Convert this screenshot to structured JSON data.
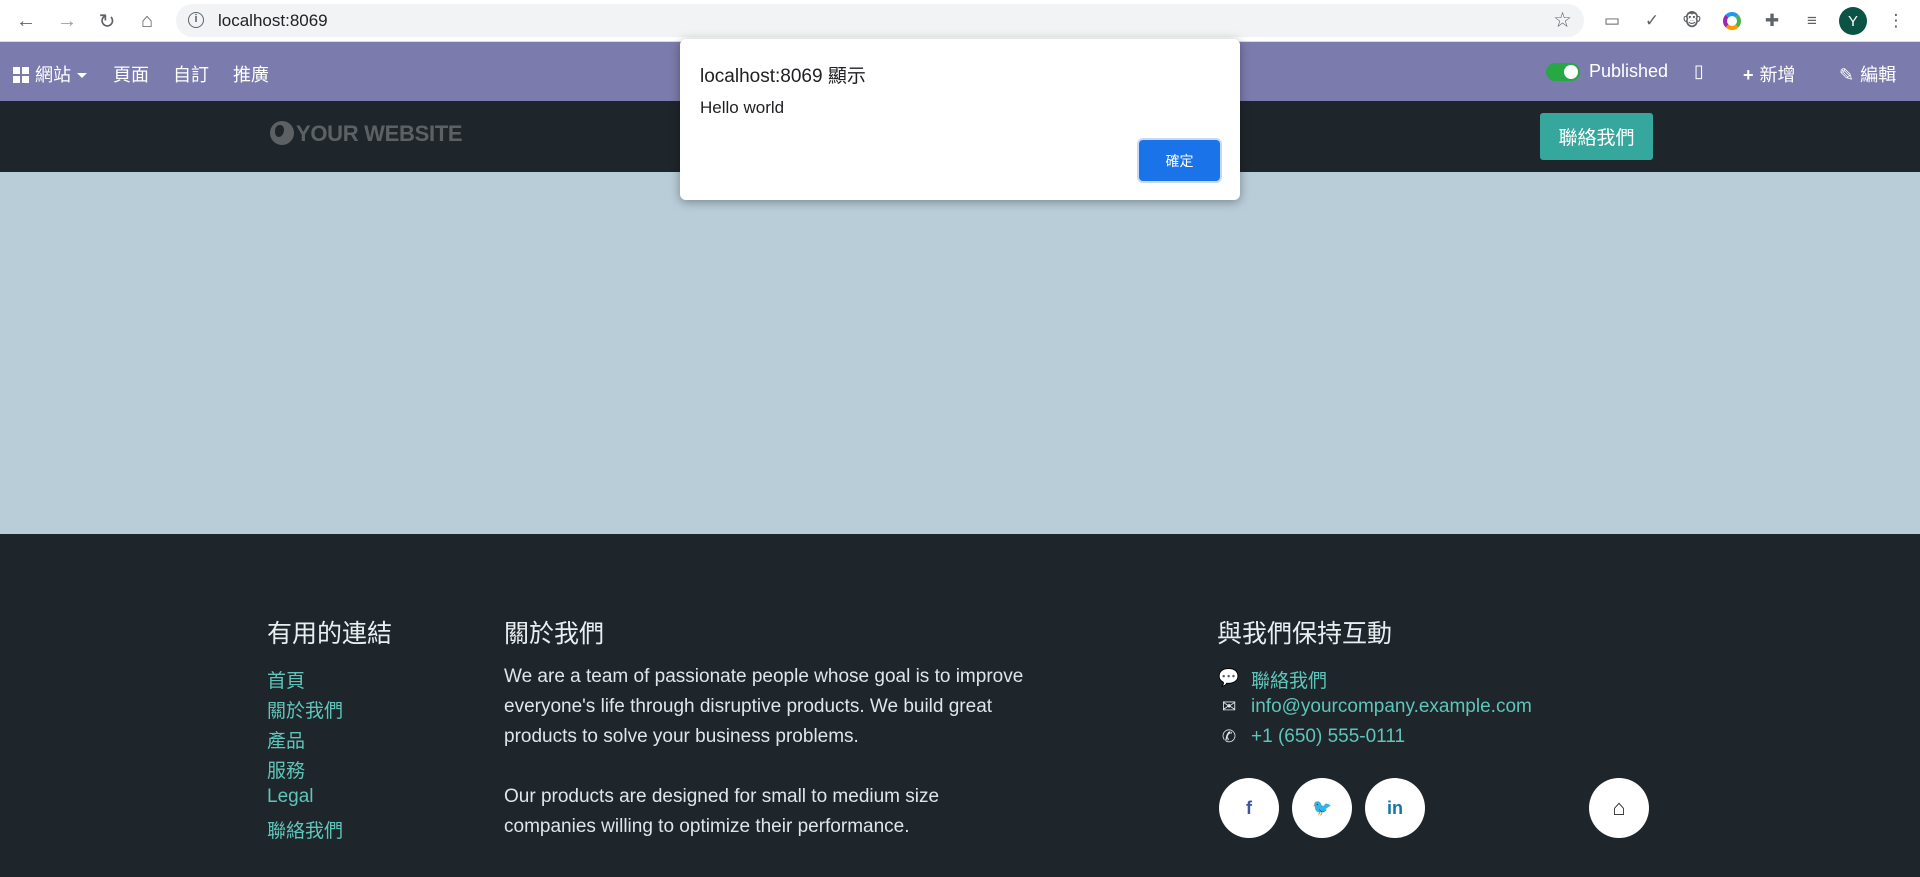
{
  "browser": {
    "url": "localhost:8069",
    "back_icon": "←",
    "forward_icon": "→",
    "reload_icon": "↻",
    "home_icon": "⌂",
    "info_icon": "i",
    "star_icon": "☆",
    "profile_initial": "Y"
  },
  "editbar": {
    "website_menu": "網站",
    "pages": "頁面",
    "customize": "自訂",
    "promote": "推廣",
    "published": "Published",
    "new_label": "新增",
    "edit_label": "編輯",
    "plus_icon": "+",
    "pencil_icon": "✎",
    "mobile_icon": "▯"
  },
  "site": {
    "logo_text": "YOUR WEBSITE",
    "contact_button": "聯絡我們"
  },
  "footer": {
    "useful_links": {
      "title": "有用的連結",
      "items": [
        "首頁",
        "關於我們",
        "產品",
        "服務",
        "Legal",
        "聯絡我們"
      ]
    },
    "about": {
      "title": "關於我們",
      "para1_lines": [
        "We are a team of passionate people whose goal is to improve",
        "everyone's life through disruptive products. We build great",
        "products to solve your business problems."
      ],
      "para2_lines": [
        "Our products are designed for small to medium size",
        "companies willing to optimize their performance."
      ]
    },
    "connect": {
      "title": "與我們保持互動",
      "contact": "聯絡我們",
      "email": "info@yourcompany.example.com",
      "phone": "+1 (650) 555-0111",
      "chat_icon": "💬",
      "mail_icon": "✉",
      "phone_icon": "✆"
    },
    "social": {
      "facebook": "f",
      "twitter": "🐦",
      "linkedin": "in",
      "home": "⌂"
    }
  },
  "dialog": {
    "title": "localhost:8069 顯示",
    "message": "Hello world",
    "ok": "確定"
  },
  "colors": {
    "editbar": "#7c7bad",
    "accent": "#35a79c",
    "footer_bg": "#1e262c",
    "main_bg": "#b8cdd8",
    "link": "#5fc4b9",
    "dialog_button": "#1a73e8"
  }
}
